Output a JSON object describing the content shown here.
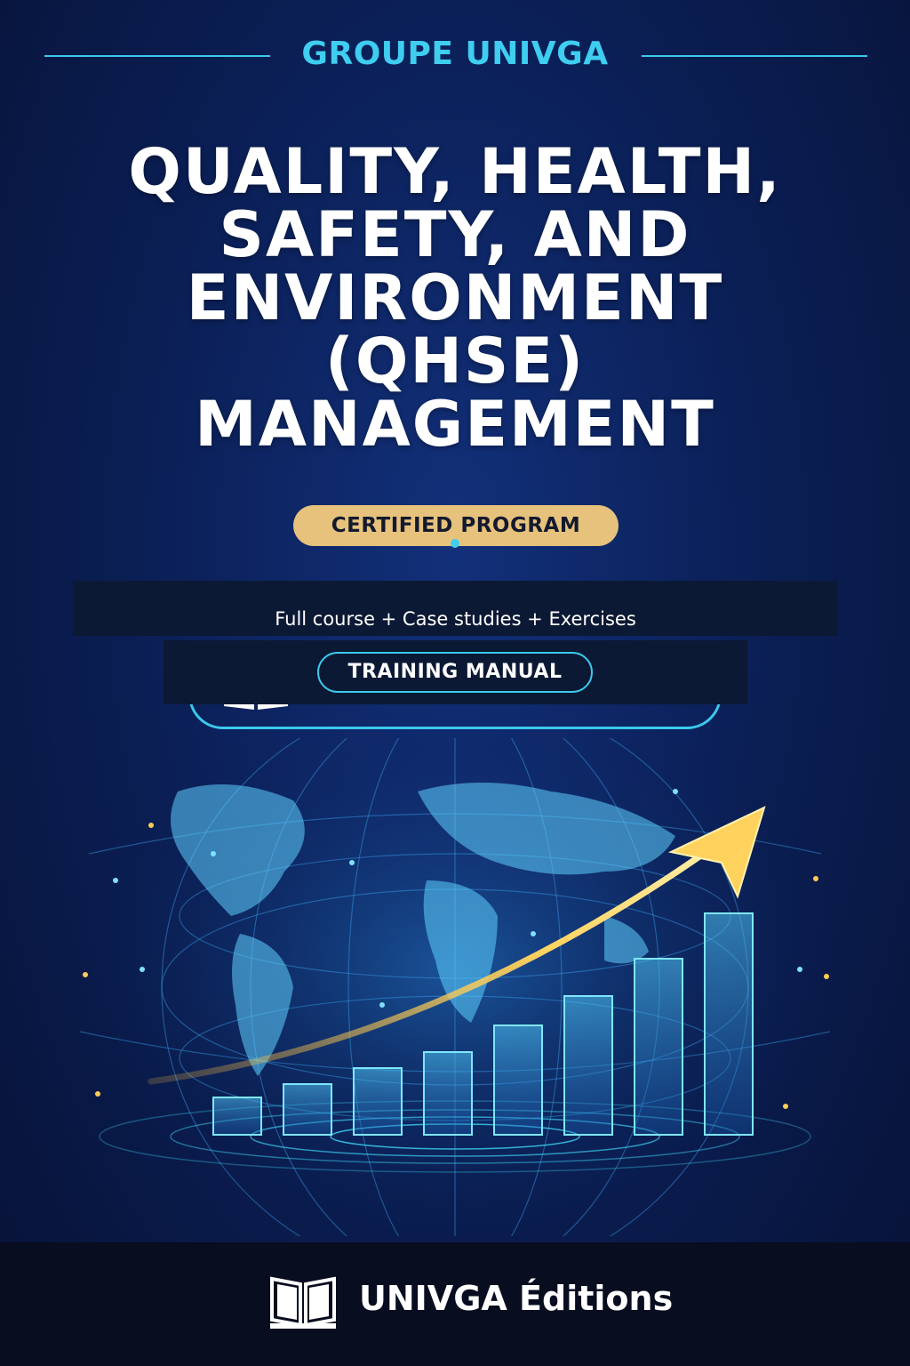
{
  "brand": "GROUPE UNIVGA",
  "title_lines": [
    "QUALITY, HEALTH,",
    "SAFETY, AND",
    "ENVIRONMENT",
    "(QHSE)",
    "MANAGEMENT"
  ],
  "badge": "CERTIFIED PROGRAM",
  "subtitle": "Full course + Case studies + Exercises",
  "manual_label": "TRAINING MANUAL",
  "publisher": "UNIVGA Éditions",
  "colors": {
    "accent": "#3fcdf0",
    "gold": "#e6c27c",
    "background": "#0b2058"
  },
  "icons": [
    "book-icon",
    "globe-illustration",
    "growth-arrow"
  ],
  "illustration_bar_levels": [
    0.14,
    0.19,
    0.25,
    0.31,
    0.41,
    0.52,
    0.66,
    0.83
  ]
}
